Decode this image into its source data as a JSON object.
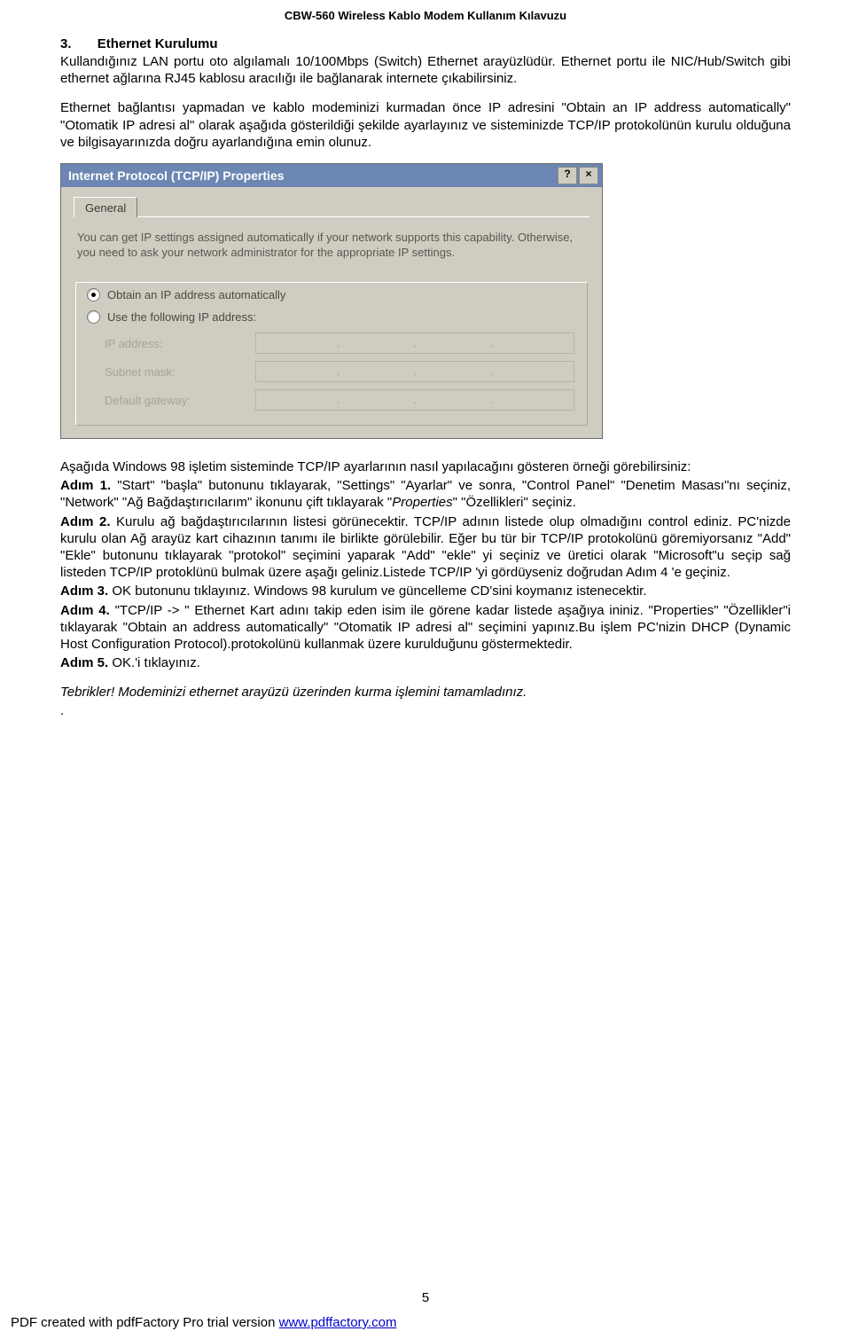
{
  "doc_header": "CBW-560 Wireless Kablo Modem Kullanım Kılavuzu",
  "section": {
    "number": "3.",
    "title": "Ethernet Kurulumu"
  },
  "para1": "Kullandığınız LAN portu oto algılamalı 10/100Mbps (Switch) Ethernet arayüzlüdür. Ethernet portu ile NIC/Hub/Switch gibi ethernet ağlarına RJ45 kablosu aracılığı ile bağlanarak internete çıkabilirsiniz.",
  "para2": "Ethernet bağlantısı yapmadan ve kablo modeminizi kurmadan önce IP adresini \"Obtain an IP address automatically\" \"Otomatik IP adresi al\" olarak aşağıda gösterildiği şekilde ayarlayınız ve sisteminizde TCP/IP protokolünün kurulu olduğuna ve bilgisayarınızda doğru ayarlandığına emin olunuz.",
  "dialog": {
    "title": "Internet Protocol (TCP/IP) Properties",
    "help_btn": "?",
    "close_btn": "×",
    "tab": "General",
    "desc": "You can get IP settings assigned automatically if your network supports this capability. Otherwise, you need to ask your network administrator for the appropriate IP settings.",
    "radio1": "Obtain an IP address automatically",
    "radio2": "Use the following IP address:",
    "ip_label": "IP address:",
    "subnet_label": "Subnet mask:",
    "gateway_label": "Default gateway:"
  },
  "after_dialog_intro": "Aşağıda Windows 98 işletim sisteminde TCP/IP ayarlarının nasıl yapılacağını gösteren örneği görebilirsiniz:",
  "steps": {
    "s1_bold": "Adım 1.",
    "s1_text_a": " \"Start\" \"başla\" butonunu tıklayarak, \"Settings\" \"Ayarlar\" ve sonra, \"Control Panel\" \"Denetim Masası\"nı seçiniz, \"Network\" \"Ağ Bağdaştırıcılarım\" ikonunu çift tıklayarak \"",
    "s1_italic": "Properties",
    "s1_text_b": "\" \"Özellikleri\" seçiniz.",
    "s2_bold": "Adım 2.",
    "s2_text": " Kurulu ağ bağdaştırıcılarının listesi görünecektir. TCP/IP adının listede olup olmadığını control ediniz. PC'nizde kurulu olan Ağ arayüz kart cihazının tanımı ile birlikte görülebilir. Eğer bu tür bir TCP/IP protokolünü göremiyorsanız \"Add\" \"Ekle\" butonunu tıklayarak \"protokol\" seçimini yaparak \"Add\" \"ekle\" yi seçiniz ve üretici olarak \"Microsoft\"u seçip sağ listeden TCP/IP protoklünü bulmak üzere aşağı geliniz.Listede TCP/IP 'yi gördüyseniz doğrudan Adım 4 'e geçiniz.",
    "s3_bold": "Adım 3.",
    "s3_text": " OK butonunu tıklayınız. Windows 98 kurulum ve güncelleme CD'sini koymanız istenecektir.",
    "s4_bold": "Adım 4.",
    "s4_text": " \"TCP/IP -> \" Ethernet Kart adını takip eden isim ile görene kadar listede aşağıya ininiz. \"Properties\" \"Özellikler\"i tıklayarak \"Obtain an address automatically\" \"Otomatik IP adresi al\" seçimini yapınız.Bu işlem PC'nizin DHCP (Dynamic Host Configuration Protocol).protokolünü kullanmak üzere kurulduğunu göstermektedir.",
    "s5_bold": "Adım 5.",
    "s5_text": " OK.'i tıklayınız."
  },
  "congrats": "Tebrikler! Modeminizi ethernet arayüzü üzerinden kurma işlemini tamamladınız.",
  "dot": ".",
  "page_number": "5",
  "pdf_footer_text": "PDF created with pdfFactory Pro trial version ",
  "pdf_link": "www.pdffactory.com"
}
